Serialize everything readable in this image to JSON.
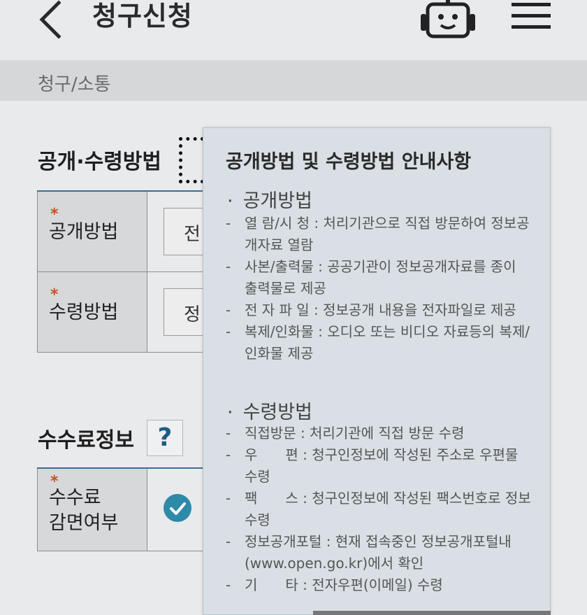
{
  "header": {
    "title": "청구신청",
    "back_icon": "chevron-left-icon",
    "bot_icon": "chatbot-icon",
    "menu_icon": "hamburger-menu-icon"
  },
  "breadcrumb": "청구/소통",
  "section_disclosure": {
    "title": "공개·수령방법",
    "rows": [
      {
        "star": "*",
        "label": "공개방법",
        "select_value": "전"
      },
      {
        "star": "*",
        "label": "수령방법",
        "select_value": "정"
      }
    ]
  },
  "section_fee": {
    "title": "수수료정보",
    "help_label": "?",
    "row": {
      "star": "*",
      "label_line1": "수수료",
      "label_line2": "감면여부"
    }
  },
  "tooltip": {
    "title": "공개방법 및 수령방법 안내사항",
    "group1": {
      "dot": "·",
      "title": "공개방법",
      "items": [
        "열 람/시 청 : 처리기관으로 직접 방문하여 정보공개자료 열람",
        "사본/출력물 : 공공기관이 정보공개자료를 종이 출력물로 제공",
        "전 자 파 일 : 정보공개 내용을 전자파일로 제공",
        "복제/인화물 : 오디오 또는 비디오 자료등의 복제/인화물 제공"
      ]
    },
    "group2": {
      "dot": "·",
      "title": "수령방법",
      "items": [
        "직접방문 : 처리기관에 직접 방문 수령",
        "우　　편 : 청구인정보에 작성된 주소로 우편물 수령",
        "팩　　스 : 청구인정보에 작성된 팩스번호로 정보 수령",
        "정보공개포털 : 현재 접속중인 정보공개포털내(www.open.go.kr)에서 확인",
        "기　　타 : 전자우편(이메일) 수령"
      ]
    },
    "dash": "-"
  }
}
